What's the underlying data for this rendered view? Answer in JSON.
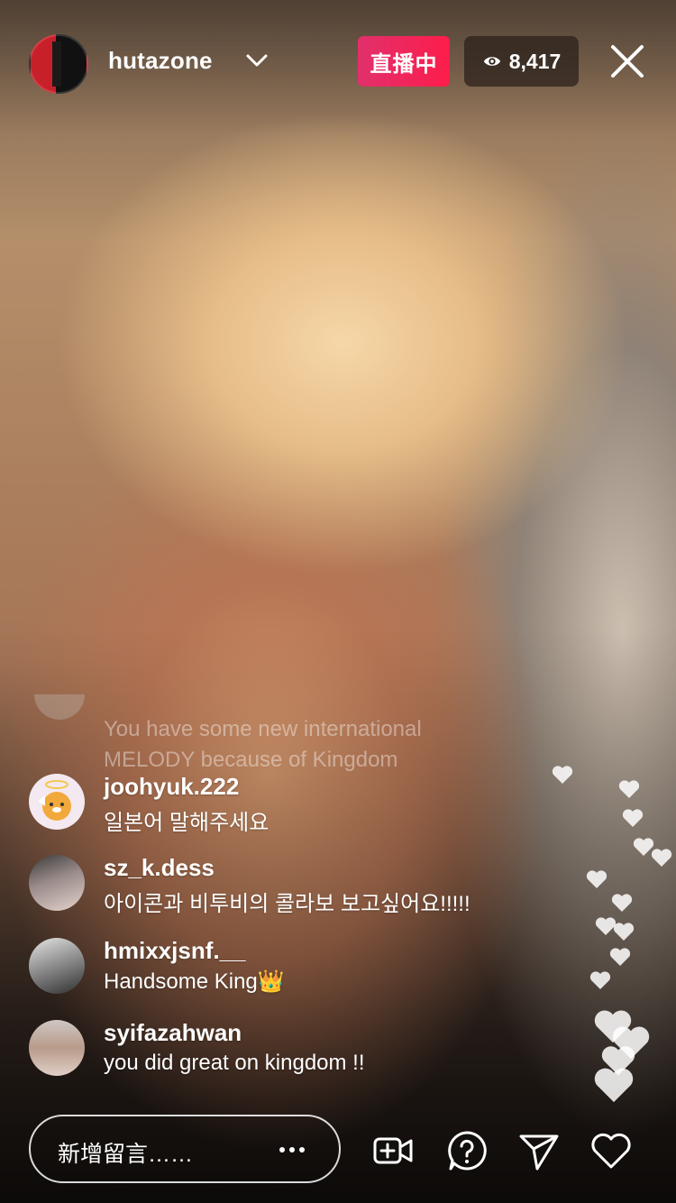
{
  "header": {
    "username": "hutazone",
    "live_label": "直播中",
    "viewer_count": "8,417"
  },
  "comments": {
    "faded": {
      "text_line1": "You have some new international",
      "text_line2": "MELODY because of Kingdom"
    },
    "items": [
      {
        "username": "joohyuk.222",
        "message": "일본어 말해주세요"
      },
      {
        "username": "sz_k.dess",
        "message": "아이콘과 비투비의 콜라보 보고싶어요!!!!!"
      },
      {
        "username": "hmixxjsnf.__",
        "message": "Handsome King👑"
      },
      {
        "username": "syifazahwan",
        "message": "you did great on kingdom !!"
      }
    ]
  },
  "footer": {
    "comment_placeholder": "新增留言……"
  },
  "colors": {
    "live_gradient_start": "#e1306c",
    "live_gradient_end": "#fd1d4b"
  },
  "icons": [
    "eye-icon",
    "close-icon",
    "chevron-down-icon",
    "more-dots-icon",
    "video-add-icon",
    "question-icon",
    "send-icon",
    "heart-icon"
  ]
}
